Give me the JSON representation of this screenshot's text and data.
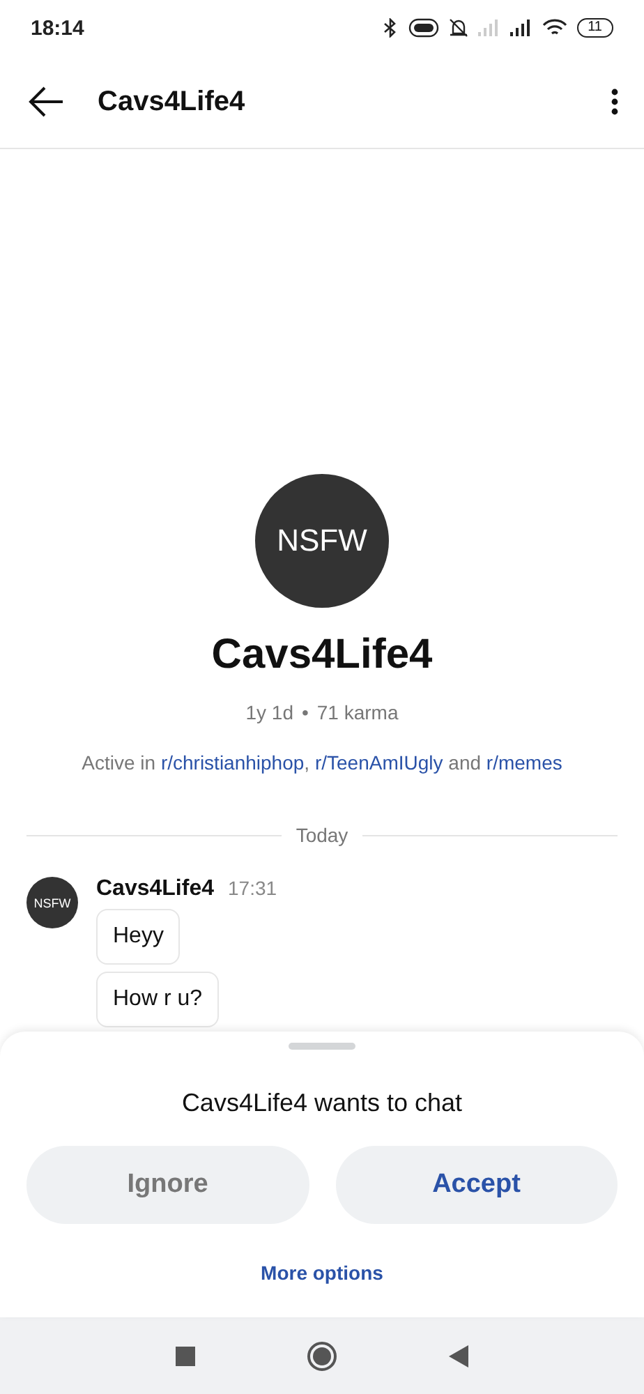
{
  "status_bar": {
    "time": "18:14",
    "battery": "11"
  },
  "header": {
    "title": "Cavs4Life4"
  },
  "profile": {
    "avatar_label": "NSFW",
    "name": "Cavs4Life4",
    "age": "1y 1d",
    "separator": "•",
    "karma": "71 karma",
    "active_in": {
      "prefix": "Active in",
      "communities": [
        {
          "name": "r/christianhiphop",
          "suffix": ","
        },
        {
          "name": "r/TeenAmIUgly",
          "suffix": "and"
        },
        {
          "name": "r/memes"
        }
      ]
    }
  },
  "date_divider": "Today",
  "messages": [
    {
      "avatar_label": "NSFW",
      "author": "Cavs4Life4",
      "time": "17:31",
      "bubbles": [
        "Heyy",
        "How r u?"
      ]
    }
  ],
  "sheet": {
    "title": "Cavs4Life4 wants to chat",
    "buttons": [
      {
        "label": "Ignore",
        "kind": "secondary"
      },
      {
        "label": "Accept",
        "kind": "primary"
      }
    ],
    "link": "More options"
  }
}
